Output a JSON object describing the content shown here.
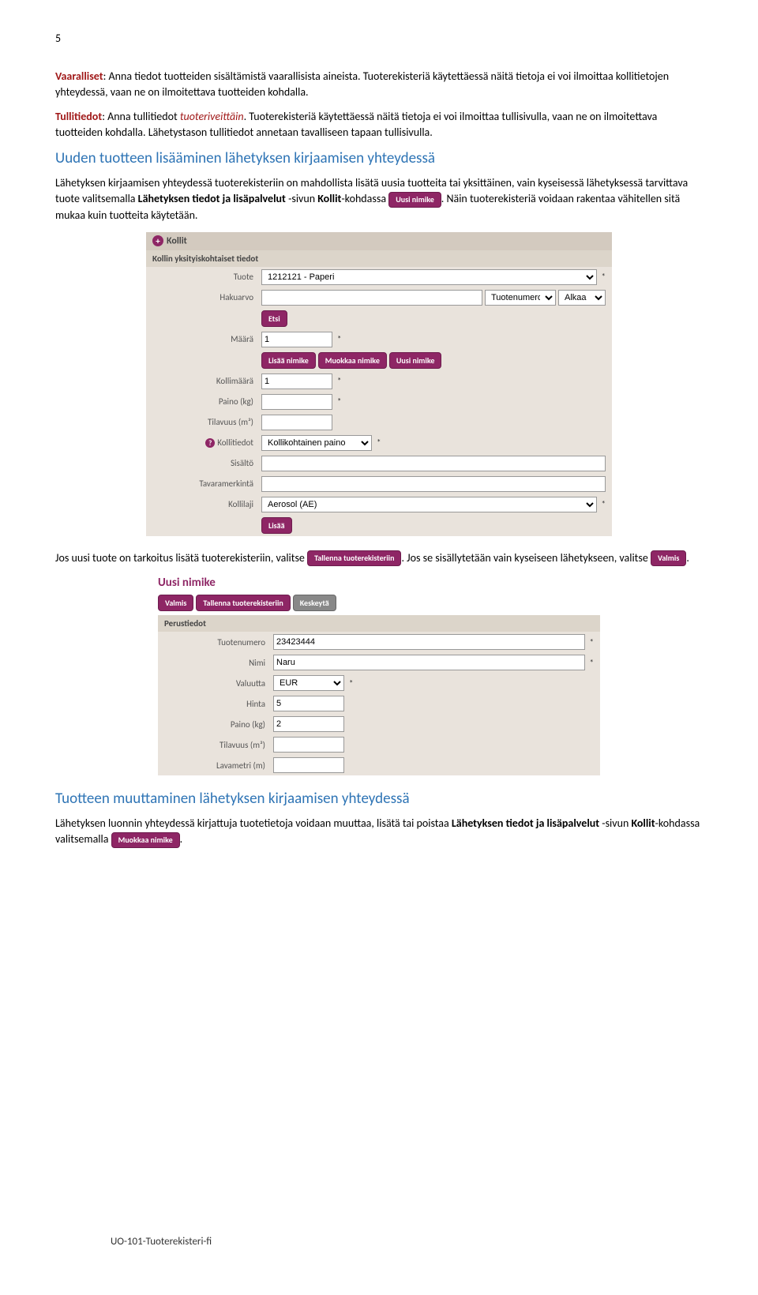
{
  "pageNumber": "5",
  "p1": {
    "label": "Vaaralliset",
    "text": ": Anna tiedot tuotteiden sisältämistä vaarallisista aineista. Tuoterekisteriä käytettäessä näitä tietoja ei voi ilmoittaa kollitietojen yhteydessä, vaan ne on ilmoitettava tuotteiden kohdalla."
  },
  "p2": {
    "label": "Tullitiedot",
    "mid": ": Anna tullitiedot ",
    "italic": "tuoteriveittäin",
    "rest": ". Tuoterekisteriä käytettäessä näitä tietoja ei voi ilmoittaa tullisivulla, vaan ne on ilmoitettava tuotteiden kohdalla. Lähetystason tullitiedot annetaan tavalliseen tapaan tullisivulla."
  },
  "h2a": "Uuden tuotteen lisääminen lähetyksen kirjaamisen yhteydessä",
  "p3a": "Lähetyksen kirjaamisen yhteydessä tuoterekisteriin on mahdollista lisätä uusia tuotteita tai yksittäinen, vain kyseisessä lähetyksessä tarvittava tuote valitsemalla ",
  "p3b": "Lähetyksen tiedot ja lisäpalvelut",
  "p3c": " -sivun ",
  "p3d": "Kollit",
  "p3e": "-kohdassa ",
  "btnUusiNimike": "Uusi nimike",
  "p3f": ". Näin tuoterekisteriä voidaan rakentaa vähitellen sitä mukaa kuin tuotteita käytetään.",
  "form1": {
    "header": "Kollit",
    "subheader": "Kollin yksityiskohtaiset tiedot",
    "labels": {
      "tuote": "Tuote",
      "hakuarvo": "Hakuarvo",
      "maara": "Määrä",
      "kollimaara": "Kollimäärä",
      "paino": "Paino (kg)",
      "tilavuus": "Tilavuus (m³)",
      "kollitiedot": "Kollitiedot",
      "sisalto": "Sisältö",
      "tavaramerkinta": "Tavaramerkintä",
      "kollilaji": "Kollilaji"
    },
    "values": {
      "tuote": "1212121 - Paperi",
      "maara": "1",
      "kollimaara": "1",
      "tuotenumero": "Tuotenumero",
      "alkaa": "Alkaa",
      "kollitiedot": "Kollikohtainen paino",
      "kollilaji": "Aerosol (AE)"
    },
    "buttons": {
      "etsi": "Etsi",
      "lisaaNimike": "Lisää nimike",
      "muokkaaNimike": "Muokkaa nimike",
      "uusiNimike": "Uusi nimike",
      "lisaa": "Lisää"
    }
  },
  "p4a": "Jos uusi tuote on tarkoitus lisätä tuoterekisteriin, valitse ",
  "btnTallenna": "Tallenna tuoterekisteriin",
  "p4b": ". Jos se sisällytetään vain kyseiseen lähetykseen, valitse ",
  "btnValmis": "Valmis",
  "p4c": ".",
  "form2": {
    "title": "Uusi nimike",
    "buttons": {
      "valmis": "Valmis",
      "tallenna": "Tallenna tuoterekisteriin",
      "keskeyta": "Keskeytä"
    },
    "header": "Perustiedot",
    "labels": {
      "tuotenumero": "Tuotenumero",
      "nimi": "Nimi",
      "valuutta": "Valuutta",
      "hinta": "Hinta",
      "paino": "Paino (kg)",
      "tilavuus": "Tilavuus (m³)",
      "lavametri": "Lavametri (m)"
    },
    "values": {
      "tuotenumero": "23423444",
      "nimi": "Naru",
      "valuutta": "EUR",
      "hinta": "5",
      "paino": "2"
    }
  },
  "h2b": "Tuotteen muuttaminen lähetyksen kirjaamisen yhteydessä",
  "p5a": "Lähetyksen luonnin yhteydessä kirjattuja tuotetietoja voidaan muuttaa, lisätä tai poistaa ",
  "p5b": "Lähetyksen tiedot ja lisäpalvelut",
  "p5c": " -sivun ",
  "p5d": "Kollit",
  "p5e": "-kohdassa valitsemalla ",
  "btnMuokkaa": "Muokkaa nimike",
  "p5f": ".",
  "footer": "UO-101-Tuoterekisteri-fi"
}
